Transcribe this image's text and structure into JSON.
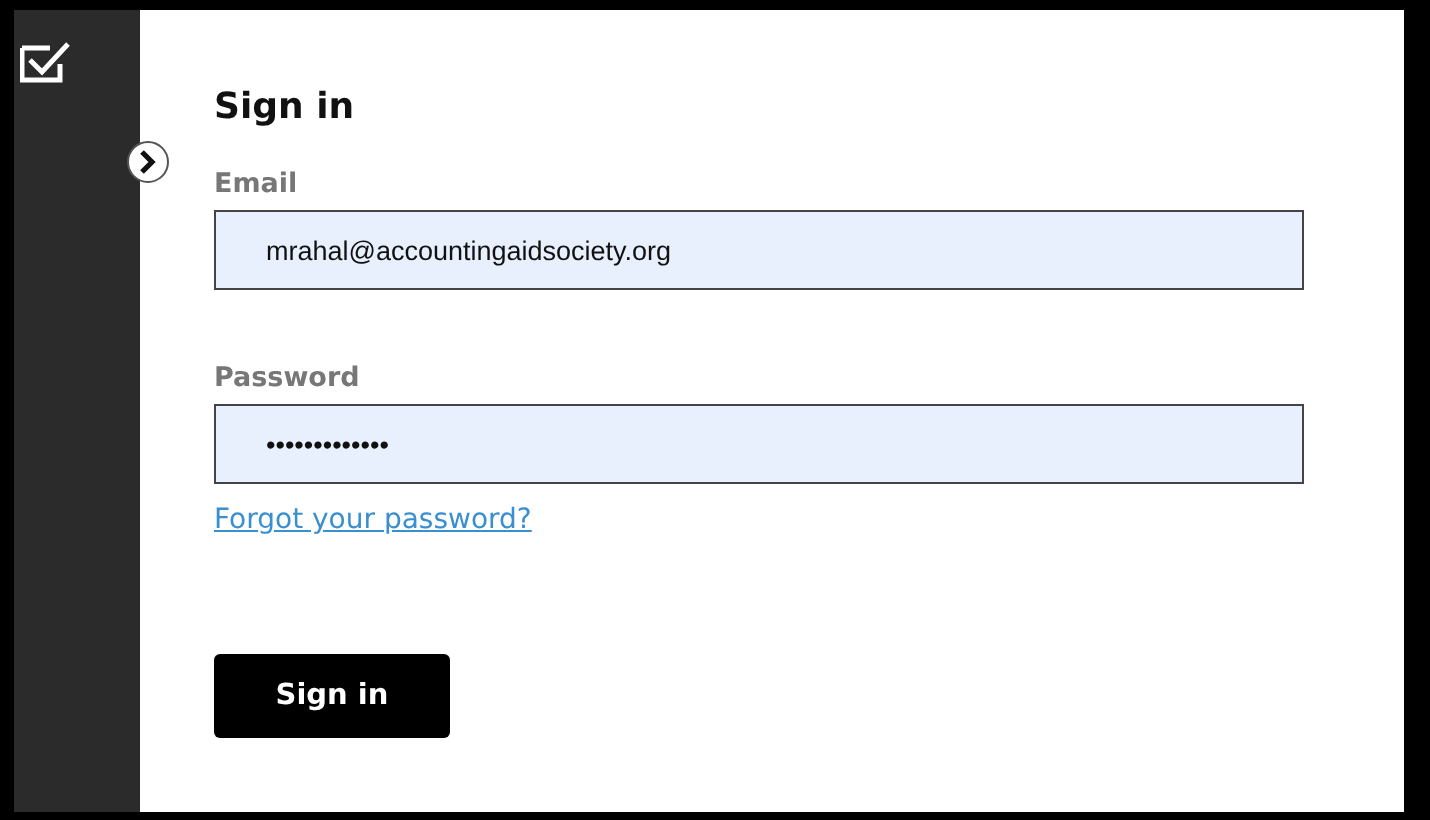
{
  "title": "Sign in",
  "fields": [
    {
      "label": "Email",
      "value": "mrahal@accountingaidsociety.org"
    },
    {
      "label": "Password",
      "value": "•••••••••••••"
    }
  ],
  "forgot_link": "Forgot your password?",
  "submit": "Sign in"
}
